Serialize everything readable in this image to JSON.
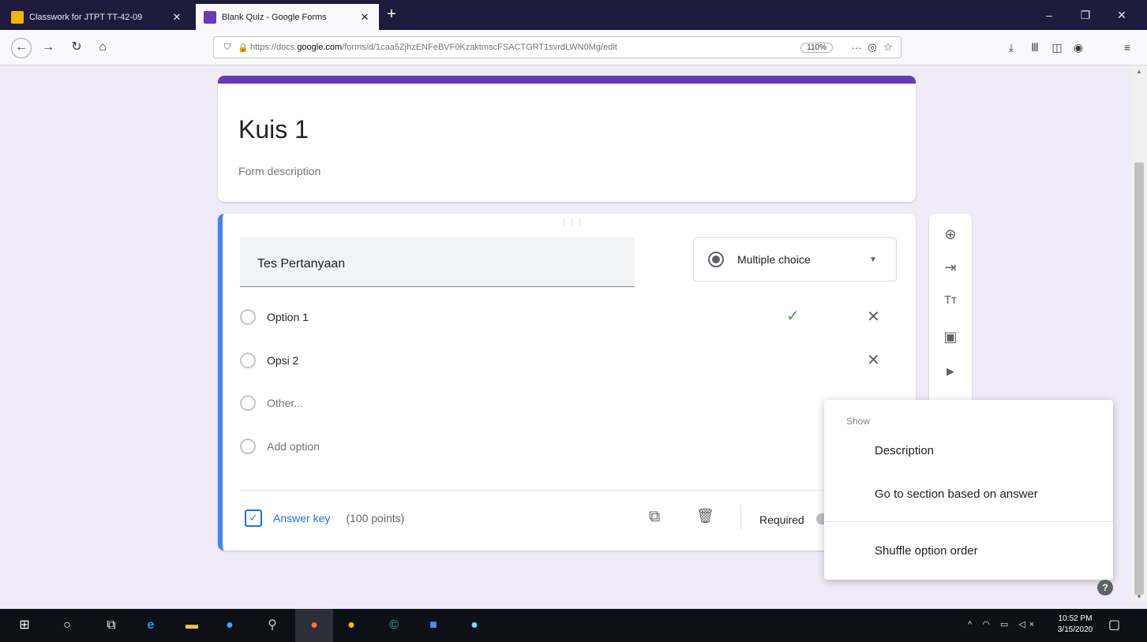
{
  "browser": {
    "tabs": [
      {
        "title": "Classwork for JTPT TT-42-09",
        "favicon_color": "#f4b400",
        "close": "✕"
      },
      {
        "title": "Blank Quiz - Google Forms",
        "favicon_color": "#673ab7",
        "close": "✕"
      }
    ],
    "new_tab": "+",
    "window_controls": {
      "minimize": "–",
      "maximize": "❐",
      "close": "✕"
    },
    "nav": {
      "back": "←",
      "forward": "→",
      "reload": "↻",
      "home": "⌂"
    },
    "url": {
      "prefix": "https://docs.",
      "domain": "google.com",
      "path": "/forms/d/1caa5ZjhzENFeBVF0KzaktmscFSACTGRT1svrdLWN0Mg/edit",
      "zoom": "110%"
    },
    "url_icons": {
      "more": "···",
      "pocket": "◎",
      "bookmark": "☆"
    },
    "toolbar_icons": {
      "download": "⤓",
      "library": "Ⅲ",
      "sidebar": "◫",
      "account": "◉",
      "menu": "≡"
    }
  },
  "form": {
    "title": "Kuis 1",
    "description_placeholder": "Form description",
    "accent_color": "#673ab7",
    "question": {
      "drag_handle": "⋮⋮⋮",
      "title": "Tes Pertanyaan",
      "type": "Multiple choice",
      "type_chevron": "▼",
      "options": [
        {
          "label": "Option 1",
          "correct": true
        },
        {
          "label": "Opsi 2",
          "correct": false
        }
      ],
      "other_label": "Other...",
      "add_option_label": "Add option",
      "answer_key_label": "Answer key",
      "points_label": "(100 points)",
      "required_label": "Required",
      "check_glyph": "✓",
      "remove_glyph": "✕"
    },
    "side_tools": [
      "⊕",
      "⇥",
      "Tт",
      "▣",
      "▶"
    ]
  },
  "menu": {
    "header": "Show",
    "items": [
      "Description",
      "Go to section based on answer",
      "Shuffle option order"
    ]
  },
  "help_glyph": "?",
  "taskbar": {
    "clock_time": "10:52 PM",
    "clock_date": "3/15/2020",
    "tray": "^ ◠ ▭ ◁×",
    "notification": "▢"
  }
}
